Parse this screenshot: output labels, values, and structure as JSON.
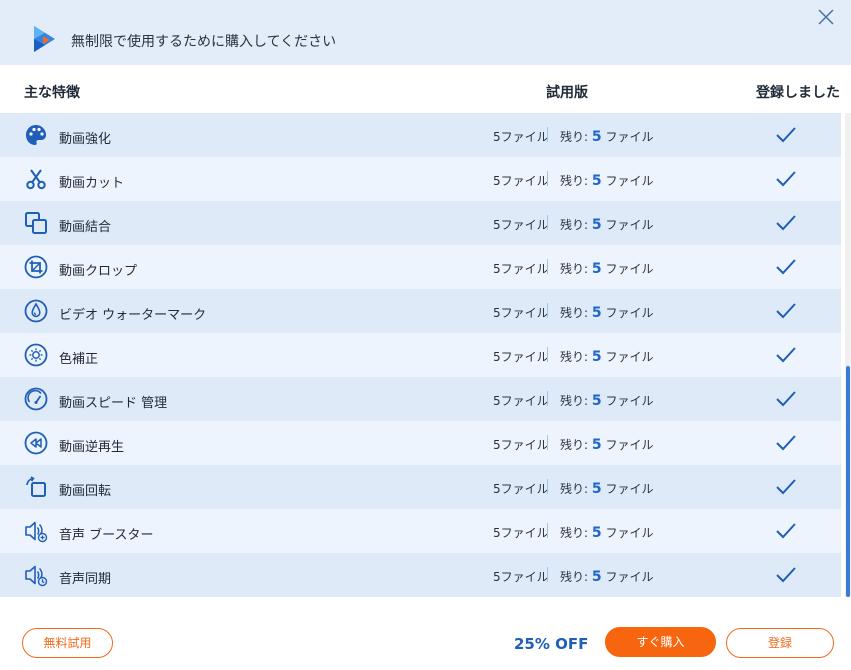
{
  "header": {
    "title": "無制限で使用するために購入してください"
  },
  "columns": {
    "feature": "主な特徴",
    "trial": "試用版",
    "registered": "登録しました"
  },
  "features": [
    {
      "icon": "palette-icon",
      "name": "動画強化",
      "files": "5ファイル",
      "remain_label": "残り:",
      "remain_count": "5",
      "remain_unit": "ファイル"
    },
    {
      "icon": "scissors-icon",
      "name": "動画カット",
      "files": "5ファイル",
      "remain_label": "残り:",
      "remain_count": "5",
      "remain_unit": "ファイル"
    },
    {
      "icon": "merge-icon",
      "name": "動画結合",
      "files": "5ファイル",
      "remain_label": "残り:",
      "remain_count": "5",
      "remain_unit": "ファイル"
    },
    {
      "icon": "crop-icon",
      "name": "動画クロップ",
      "files": "5ファイル",
      "remain_label": "残り:",
      "remain_count": "5",
      "remain_unit": "ファイル"
    },
    {
      "icon": "watermark-icon",
      "name": "ビデオ ウォーターマーク",
      "files": "5ファイル",
      "remain_label": "残り:",
      "remain_count": "5",
      "remain_unit": "ファイル"
    },
    {
      "icon": "color-correction-icon",
      "name": "色補正",
      "files": "5ファイル",
      "remain_label": "残り:",
      "remain_count": "5",
      "remain_unit": "ファイル"
    },
    {
      "icon": "speedometer-icon",
      "name": "動画スピード 管理",
      "files": "5ファイル",
      "remain_label": "残り:",
      "remain_count": "5",
      "remain_unit": "ファイル"
    },
    {
      "icon": "reverse-icon",
      "name": "動画逆再生",
      "files": "5ファイル",
      "remain_label": "残り:",
      "remain_count": "5",
      "remain_unit": "ファイル"
    },
    {
      "icon": "rotate-icon",
      "name": "動画回転",
      "files": "5ファイル",
      "remain_label": "残り:",
      "remain_count": "5",
      "remain_unit": "ファイル"
    },
    {
      "icon": "volume-booster-icon",
      "name": "音声 ブースター",
      "files": "5ファイル",
      "remain_label": "残り:",
      "remain_count": "5",
      "remain_unit": "ファイル"
    },
    {
      "icon": "audio-sync-icon",
      "name": "音声同期",
      "files": "5ファイル",
      "remain_label": "残り:",
      "remain_count": "5",
      "remain_unit": "ファイル"
    }
  ],
  "footer": {
    "trial_button": "無料試用",
    "discount": "25% OFF",
    "buy_button": "すぐ購入",
    "register_button": "登録"
  },
  "colors": {
    "accent": "#f7650f",
    "brand_blue": "#1f67c9",
    "row_dark": "#dfeaf9",
    "row_light": "#eef4fd"
  }
}
